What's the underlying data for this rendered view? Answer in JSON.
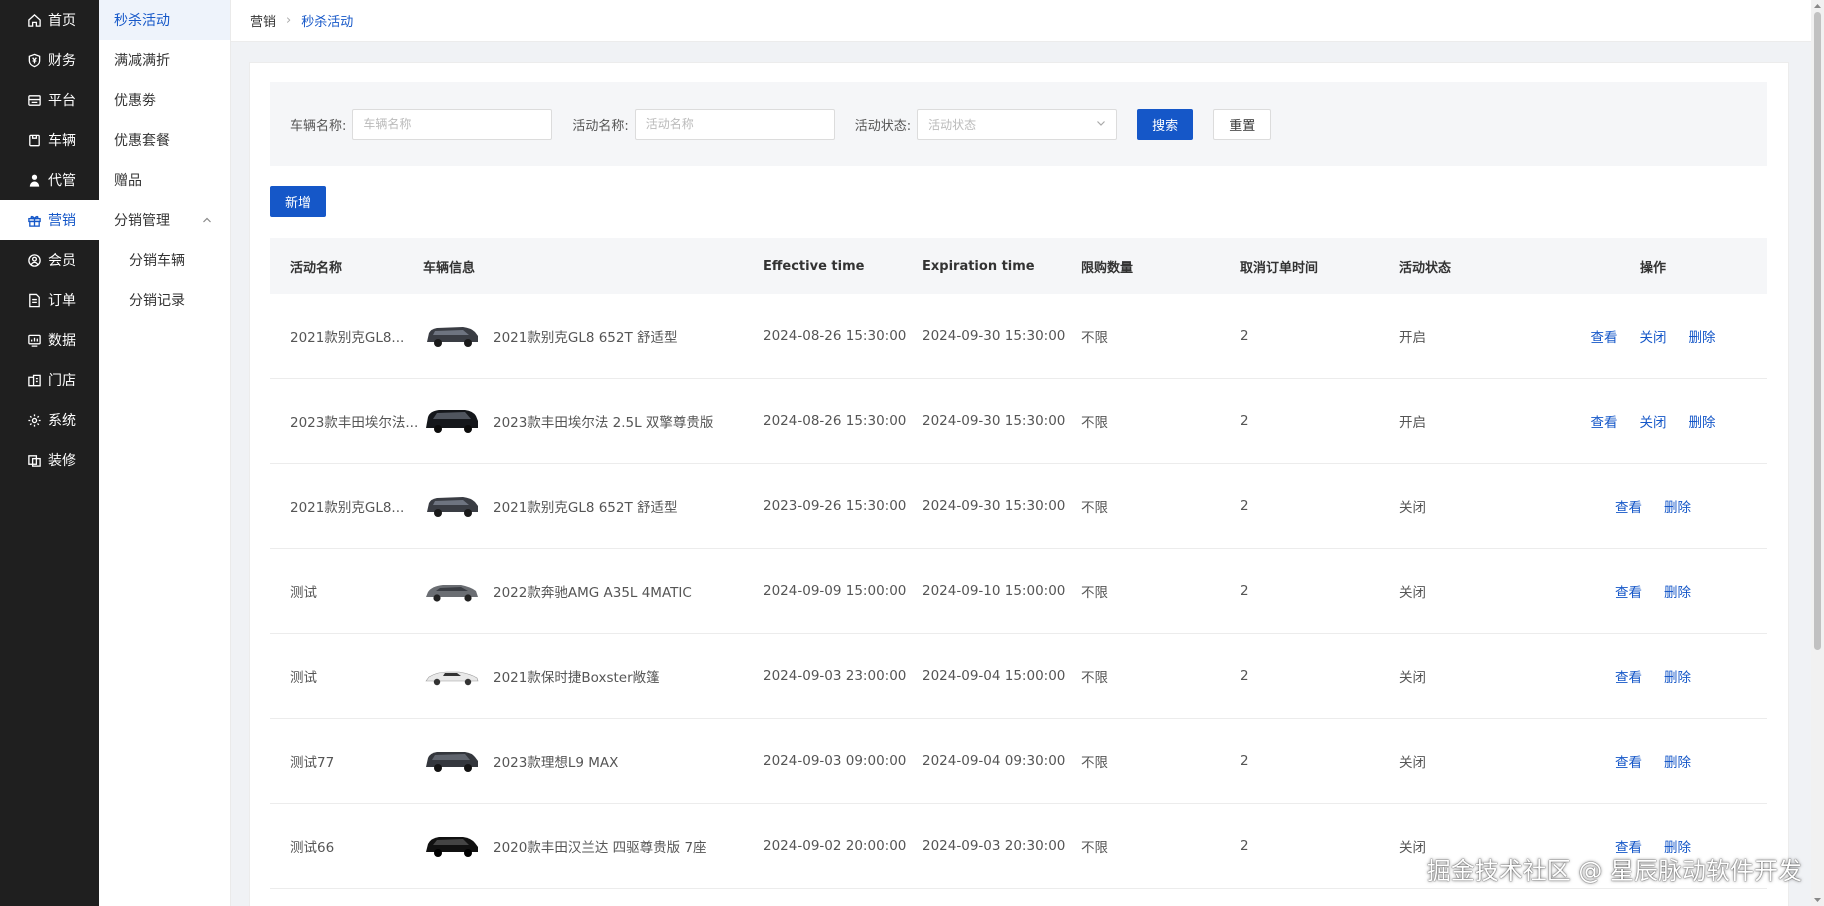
{
  "nav": {
    "items": [
      {
        "label": "首页",
        "icon": "home-icon"
      },
      {
        "label": "财务",
        "icon": "finance-icon"
      },
      {
        "label": "平台",
        "icon": "platform-icon"
      },
      {
        "label": "车辆",
        "icon": "vehicle-icon"
      },
      {
        "label": "代管",
        "icon": "agent-icon"
      },
      {
        "label": "营销",
        "icon": "gift-icon"
      },
      {
        "label": "会员",
        "icon": "member-icon"
      },
      {
        "label": "订单",
        "icon": "order-icon"
      },
      {
        "label": "数据",
        "icon": "data-icon"
      },
      {
        "label": "门店",
        "icon": "store-icon"
      },
      {
        "label": "系统",
        "icon": "gear-icon"
      },
      {
        "label": "装修",
        "icon": "decorate-icon"
      }
    ],
    "active_index": 5
  },
  "submenu": {
    "items": [
      "秒杀活动",
      "满减满折",
      "优惠劵",
      "优惠套餐",
      "赠品"
    ],
    "group": "分销管理",
    "children": [
      "分销车辆",
      "分销记录"
    ]
  },
  "breadcrumb": {
    "parent": "营销",
    "current": "秒杀活动"
  },
  "filter": {
    "vehicle_label": "车辆名称:",
    "vehicle_placeholder": "车辆名称",
    "activity_label": "活动名称:",
    "activity_placeholder": "活动名称",
    "status_label": "活动状态:",
    "status_placeholder": "活动状态",
    "search": "搜索",
    "reset": "重置"
  },
  "add_button": "新增",
  "table": {
    "columns": [
      "活动名称",
      "车辆信息",
      "Effective time",
      "Expiration time",
      "限购数量",
      "取消订单时间",
      "活动状态",
      "操作"
    ],
    "rows": [
      {
        "name": "2021款别克GL8...",
        "car": "2021款别克GL8 652T 舒适型",
        "start": "2024-08-26 15:30:00",
        "end": "2024-09-30 15:30:00",
        "limit": "不限",
        "cancel": "2",
        "status": "开启"
      },
      {
        "name": "2023款丰田埃尔法...",
        "car": "2023款丰田埃尔法 2.5L 双擎尊贵版",
        "start": "2024-08-26 15:30:00",
        "end": "2024-09-30 15:30:00",
        "limit": "不限",
        "cancel": "2",
        "status": "开启"
      },
      {
        "name": "2021款别克GL8...",
        "car": "2021款别克GL8 652T 舒适型",
        "start": "2023-09-26 15:30:00",
        "end": "2024-09-30 15:30:00",
        "limit": "不限",
        "cancel": "2",
        "status": "关闭"
      },
      {
        "name": "测试",
        "car": "2022款奔驰AMG A35L 4MATIC",
        "start": "2024-09-09 15:00:00",
        "end": "2024-09-10 15:00:00",
        "limit": "不限",
        "cancel": "2",
        "status": "关闭"
      },
      {
        "name": "测试",
        "car": "2021款保时捷Boxster敞篷",
        "start": "2024-09-03 23:00:00",
        "end": "2024-09-04 15:00:00",
        "limit": "不限",
        "cancel": "2",
        "status": "关闭"
      },
      {
        "name": "测试77",
        "car": "2023款理想L9 MAX",
        "start": "2024-09-03 09:00:00",
        "end": "2024-09-04 09:30:00",
        "limit": "不限",
        "cancel": "2",
        "status": "关闭"
      },
      {
        "name": "测试66",
        "car": "2020款丰田汉兰达 四驱尊贵版 7座",
        "start": "2024-09-02 20:00:00",
        "end": "2024-09-03 20:30:00",
        "limit": "不限",
        "cancel": "2",
        "status": "关闭"
      }
    ],
    "actions": {
      "view": "查看",
      "close": "关闭",
      "delete": "删除"
    }
  },
  "watermark": "掘金技术社区 @ 星辰脉动软件开发",
  "colors": {
    "primary": "#1557c8",
    "nav_bg": "#1f1f1f"
  }
}
